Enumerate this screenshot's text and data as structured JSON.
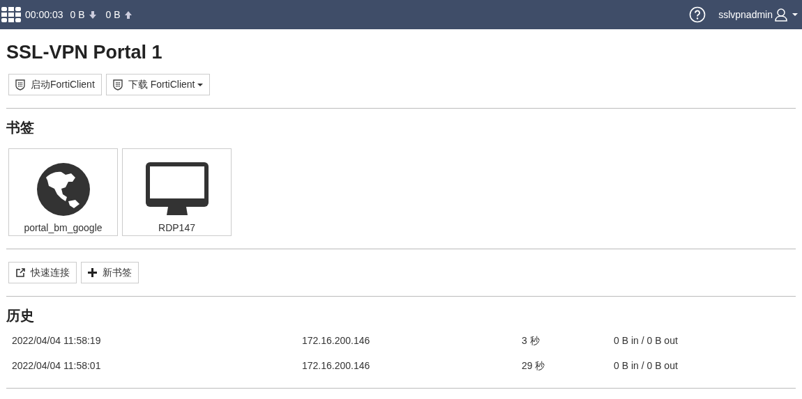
{
  "top_bar": {
    "session_time": "00:00:03",
    "download": "0 B",
    "upload": "0 B",
    "user": "sslvpnadmin"
  },
  "title": "SSL-VPN Portal 1",
  "client_buttons": [
    {
      "label": "启动FortiClient",
      "dropdown": false
    },
    {
      "label": "下载 FortiClient",
      "dropdown": true
    }
  ],
  "bookmarks_heading": "书签",
  "bookmarks": [
    {
      "kind": "web",
      "label": "portal_bm_google"
    },
    {
      "kind": "rdp",
      "label": "RDP147"
    }
  ],
  "bookmark_actions": [
    {
      "kind": "quick-connect",
      "label": "快速连接"
    },
    {
      "kind": "new",
      "label": "新书签"
    }
  ],
  "history_heading": "历史",
  "history": [
    {
      "time": "2022/04/04 11:58:19",
      "ip": "172.16.200.146",
      "duration": "3 秒",
      "traffic": "0 B in / 0 B out"
    },
    {
      "time": "2022/04/04 11:58:01",
      "ip": "172.16.200.146",
      "duration": "29 秒",
      "traffic": "0 B in / 0 B out"
    }
  ]
}
